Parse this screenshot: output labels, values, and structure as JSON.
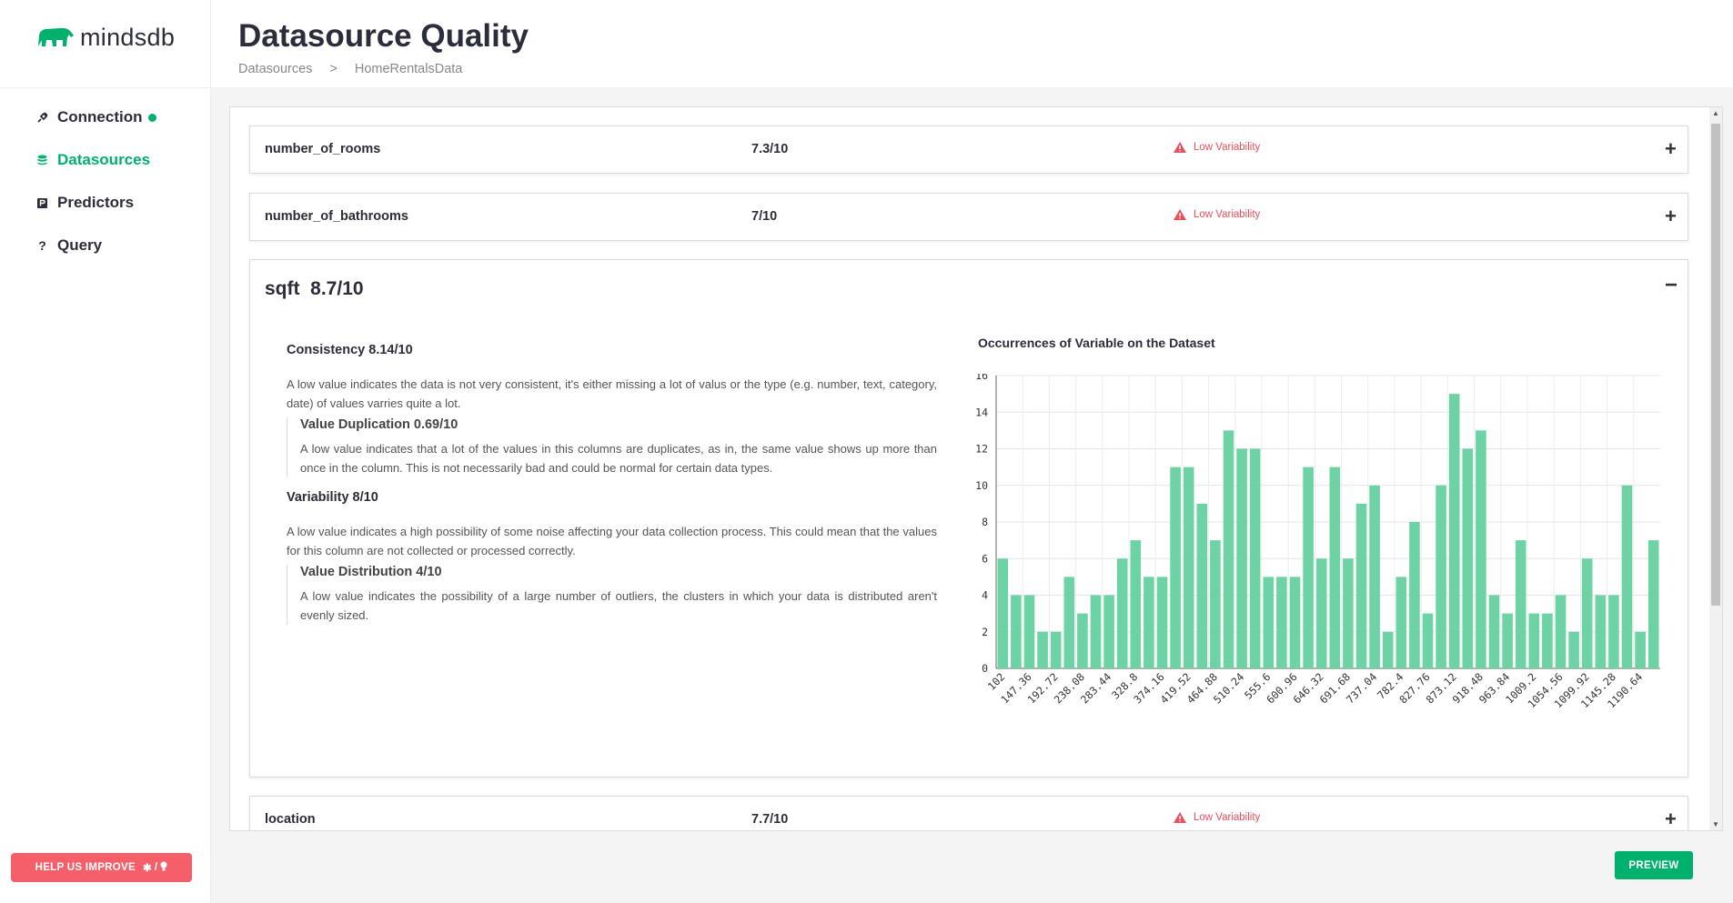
{
  "brand": {
    "name": "mindsdb",
    "color": "#00b06d"
  },
  "sidebar": {
    "items": [
      {
        "label": "Connection",
        "icon": "plug-icon",
        "status": "connected"
      },
      {
        "label": "Datasources",
        "icon": "database-icon",
        "active": true
      },
      {
        "label": "Predictors",
        "icon": "predictor-icon"
      },
      {
        "label": "Query",
        "icon": "question-icon"
      }
    ],
    "help_label": "HELP US IMPROVE"
  },
  "header": {
    "title": "Datasource Quality",
    "breadcrumb": [
      "Datasources",
      ">",
      "HomeRentalsData"
    ]
  },
  "rows": [
    {
      "name": "number_of_rooms",
      "score": "7.3/10",
      "warning": "Low Variability"
    },
    {
      "name": "number_of_bathrooms",
      "score": "7/10",
      "warning": "Low Variability"
    },
    {
      "name": "location",
      "score": "7.7/10",
      "warning": "Low Variability"
    }
  ],
  "expanded": {
    "name": "sqft",
    "score": "8.7/10",
    "consistency": {
      "title": "Consistency 8.14/10",
      "desc": "A low value indicates the data is not very consistent, it's either missing a lot of valus or the type (e.g. number, text, category, date) of values varries quite a lot."
    },
    "duplication": {
      "title": "Value Duplication 0.69/10",
      "desc": "A low value indicates that a lot of the values in this columns are duplicates, as in, the same value shows up more than once in the column. This is not necessarily bad and could be normal for certain data types."
    },
    "variability": {
      "title": "Variability 8/10",
      "desc": "A low value indicates a high possibility of some noise affecting your data collection process. This could mean that the values for this column are not collected or processed correctly."
    },
    "distribution": {
      "title": "Value Distribution 4/10",
      "desc": "A low value indicates the possibility of a large number of outliers, the clusters in which your data is distributed aren't evenly sized."
    },
    "chart_title": "Occurrences of Variable on the Dataset"
  },
  "chart_data": {
    "type": "bar",
    "title": "Occurrences of Variable on the Dataset",
    "xlabel": "",
    "ylabel": "",
    "ylim": [
      0,
      16
    ],
    "yticks": [
      0,
      2,
      4,
      6,
      8,
      10,
      12,
      14,
      16
    ],
    "grid": true,
    "color": "#6dd3a4",
    "categories": [
      "102",
      "",
      "147.36",
      "",
      "192.72",
      "",
      "238.08",
      "",
      "283.44",
      "",
      "328.8",
      "",
      "374.16",
      "",
      "419.52",
      "",
      "464.88",
      "",
      "510.24",
      "",
      "555.6",
      "",
      "600.96",
      "",
      "646.32",
      "",
      "691.68",
      "",
      "737.04",
      "",
      "782.4",
      "",
      "827.76",
      "",
      "873.12",
      "",
      "918.48",
      "",
      "963.84",
      "",
      "1009.2",
      "",
      "1054.56",
      "",
      "1099.92",
      "",
      "1145.28",
      "",
      "1190.64",
      ""
    ],
    "values": [
      6,
      4,
      4,
      2,
      2,
      5,
      3,
      4,
      4,
      6,
      7,
      5,
      5,
      11,
      11,
      9,
      7,
      13,
      12,
      12,
      5,
      5,
      5,
      11,
      6,
      11,
      6,
      9,
      10,
      2,
      5,
      8,
      3,
      10,
      15,
      12,
      13,
      4,
      3,
      7,
      3,
      3,
      4,
      2,
      6,
      4,
      4,
      10,
      2,
      7
    ]
  },
  "preview_label": "PREVIEW"
}
